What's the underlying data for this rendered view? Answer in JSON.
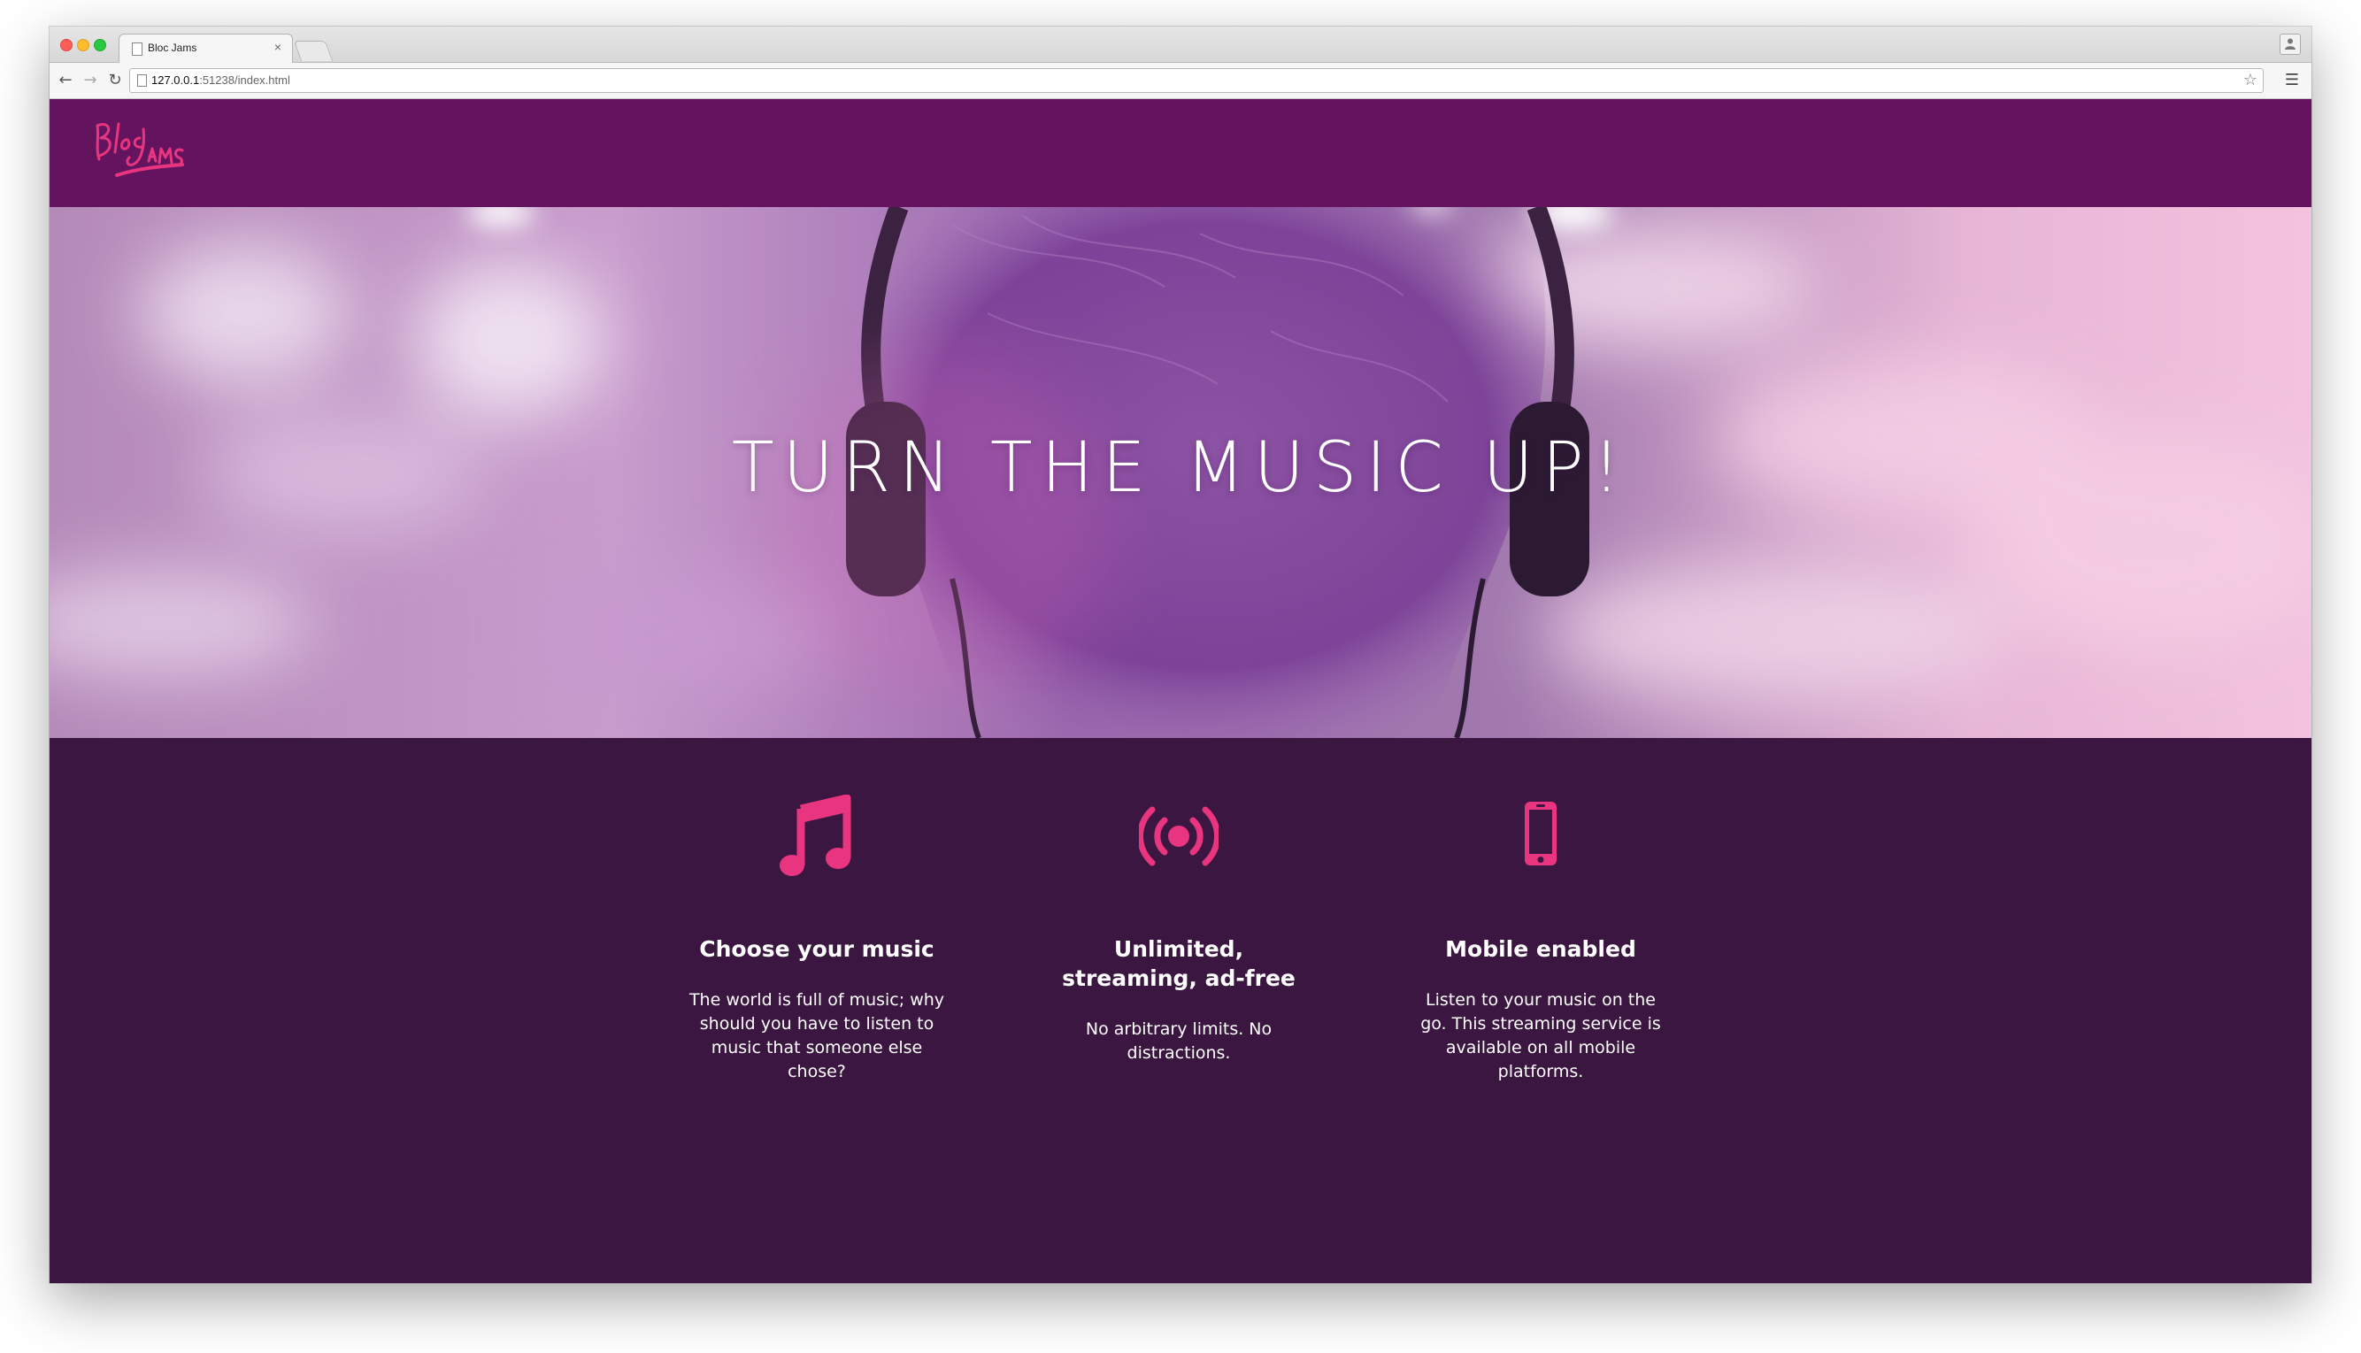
{
  "browser": {
    "tab_title": "Bloc Jams",
    "tab_close": "×",
    "url_host": "127.0.0.1",
    "url_rest": ":51238/index.html"
  },
  "navbar": {
    "logo_text": "Bloc Jams",
    "logo_icon": "bloc-jams-logo"
  },
  "hero": {
    "title": "TURN THE MUSIC UP!"
  },
  "features": [
    {
      "icon": "music-note-icon",
      "title": "Choose your music",
      "text": "The world is full of music; why should you have to listen to music that someone else chose?"
    },
    {
      "icon": "broadcast-icon",
      "title": "Unlimited, streaming, ad-free",
      "text": "No arbitrary limits. No distractions."
    },
    {
      "icon": "mobile-phone-icon",
      "title": "Mobile enabled",
      "text": "Listen to your music on the go. This streaming service is available on all mobile platforms."
    }
  ],
  "colors": {
    "navbar": "#64145e",
    "features_bg": "#3b1640",
    "accent": "#e9347f",
    "text": "#ffffff"
  }
}
